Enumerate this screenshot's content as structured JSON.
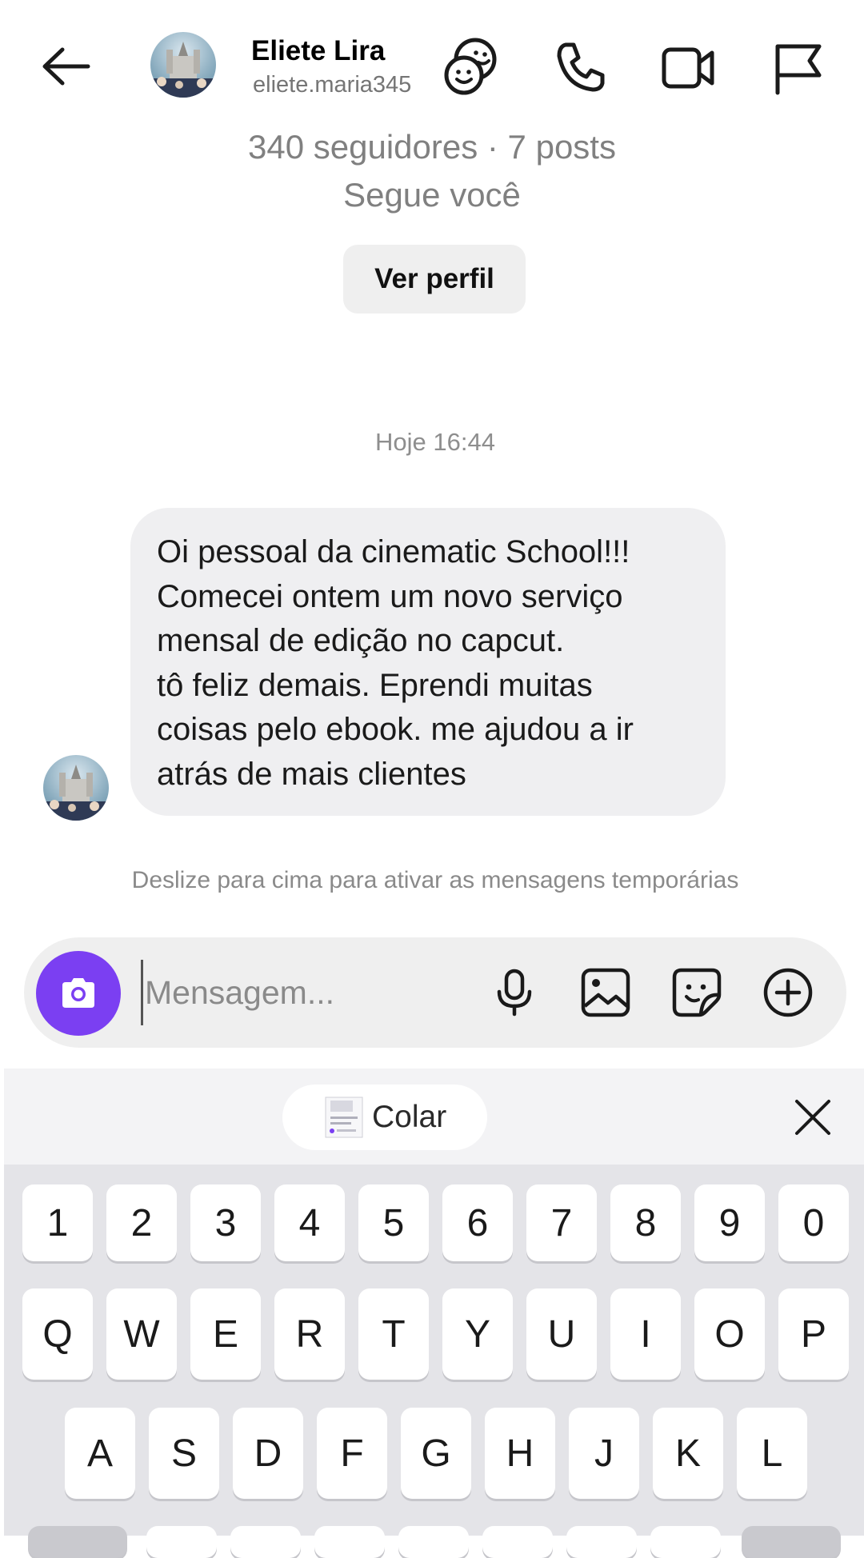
{
  "header": {
    "name": "Eliete Lira",
    "username": "eliete.maria345",
    "icons": [
      "back-arrow-icon",
      "avatar",
      "theme-sticker-icon",
      "phone-icon",
      "video-camera-icon",
      "flag-icon"
    ]
  },
  "profile": {
    "stats": "340 seguidores · 7 posts",
    "follows_you": "Segue você",
    "view_profile_label": "Ver perfil"
  },
  "chat": {
    "timestamp": "Hoje 16:44",
    "message_lines": [
      "Oi pessoal da cinematic School!!!",
      "Comecei ontem um novo serviço",
      "mensal de edição no capcut.",
      "tô feliz demais. Eprendi muitas",
      "coisas pelo ebook. me ajudou a ir",
      "atrás de mais clientes"
    ],
    "vanish_hint": "Deslize para cima para ativar as mensagens temporárias"
  },
  "composer": {
    "placeholder": "Mensagem...",
    "accent_color": "#7b3ff2",
    "icons": [
      "camera-icon",
      "microphone-icon",
      "gallery-icon",
      "sticker-icon",
      "add-icon"
    ]
  },
  "keyboard": {
    "paste_label": "Colar",
    "number_row": [
      "1",
      "2",
      "3",
      "4",
      "5",
      "6",
      "7",
      "8",
      "9",
      "0"
    ],
    "row1": [
      "Q",
      "W",
      "E",
      "R",
      "T",
      "Y",
      "U",
      "I",
      "O",
      "P"
    ],
    "row2": [
      "A",
      "S",
      "D",
      "F",
      "G",
      "H",
      "J",
      "K",
      "L"
    ]
  }
}
